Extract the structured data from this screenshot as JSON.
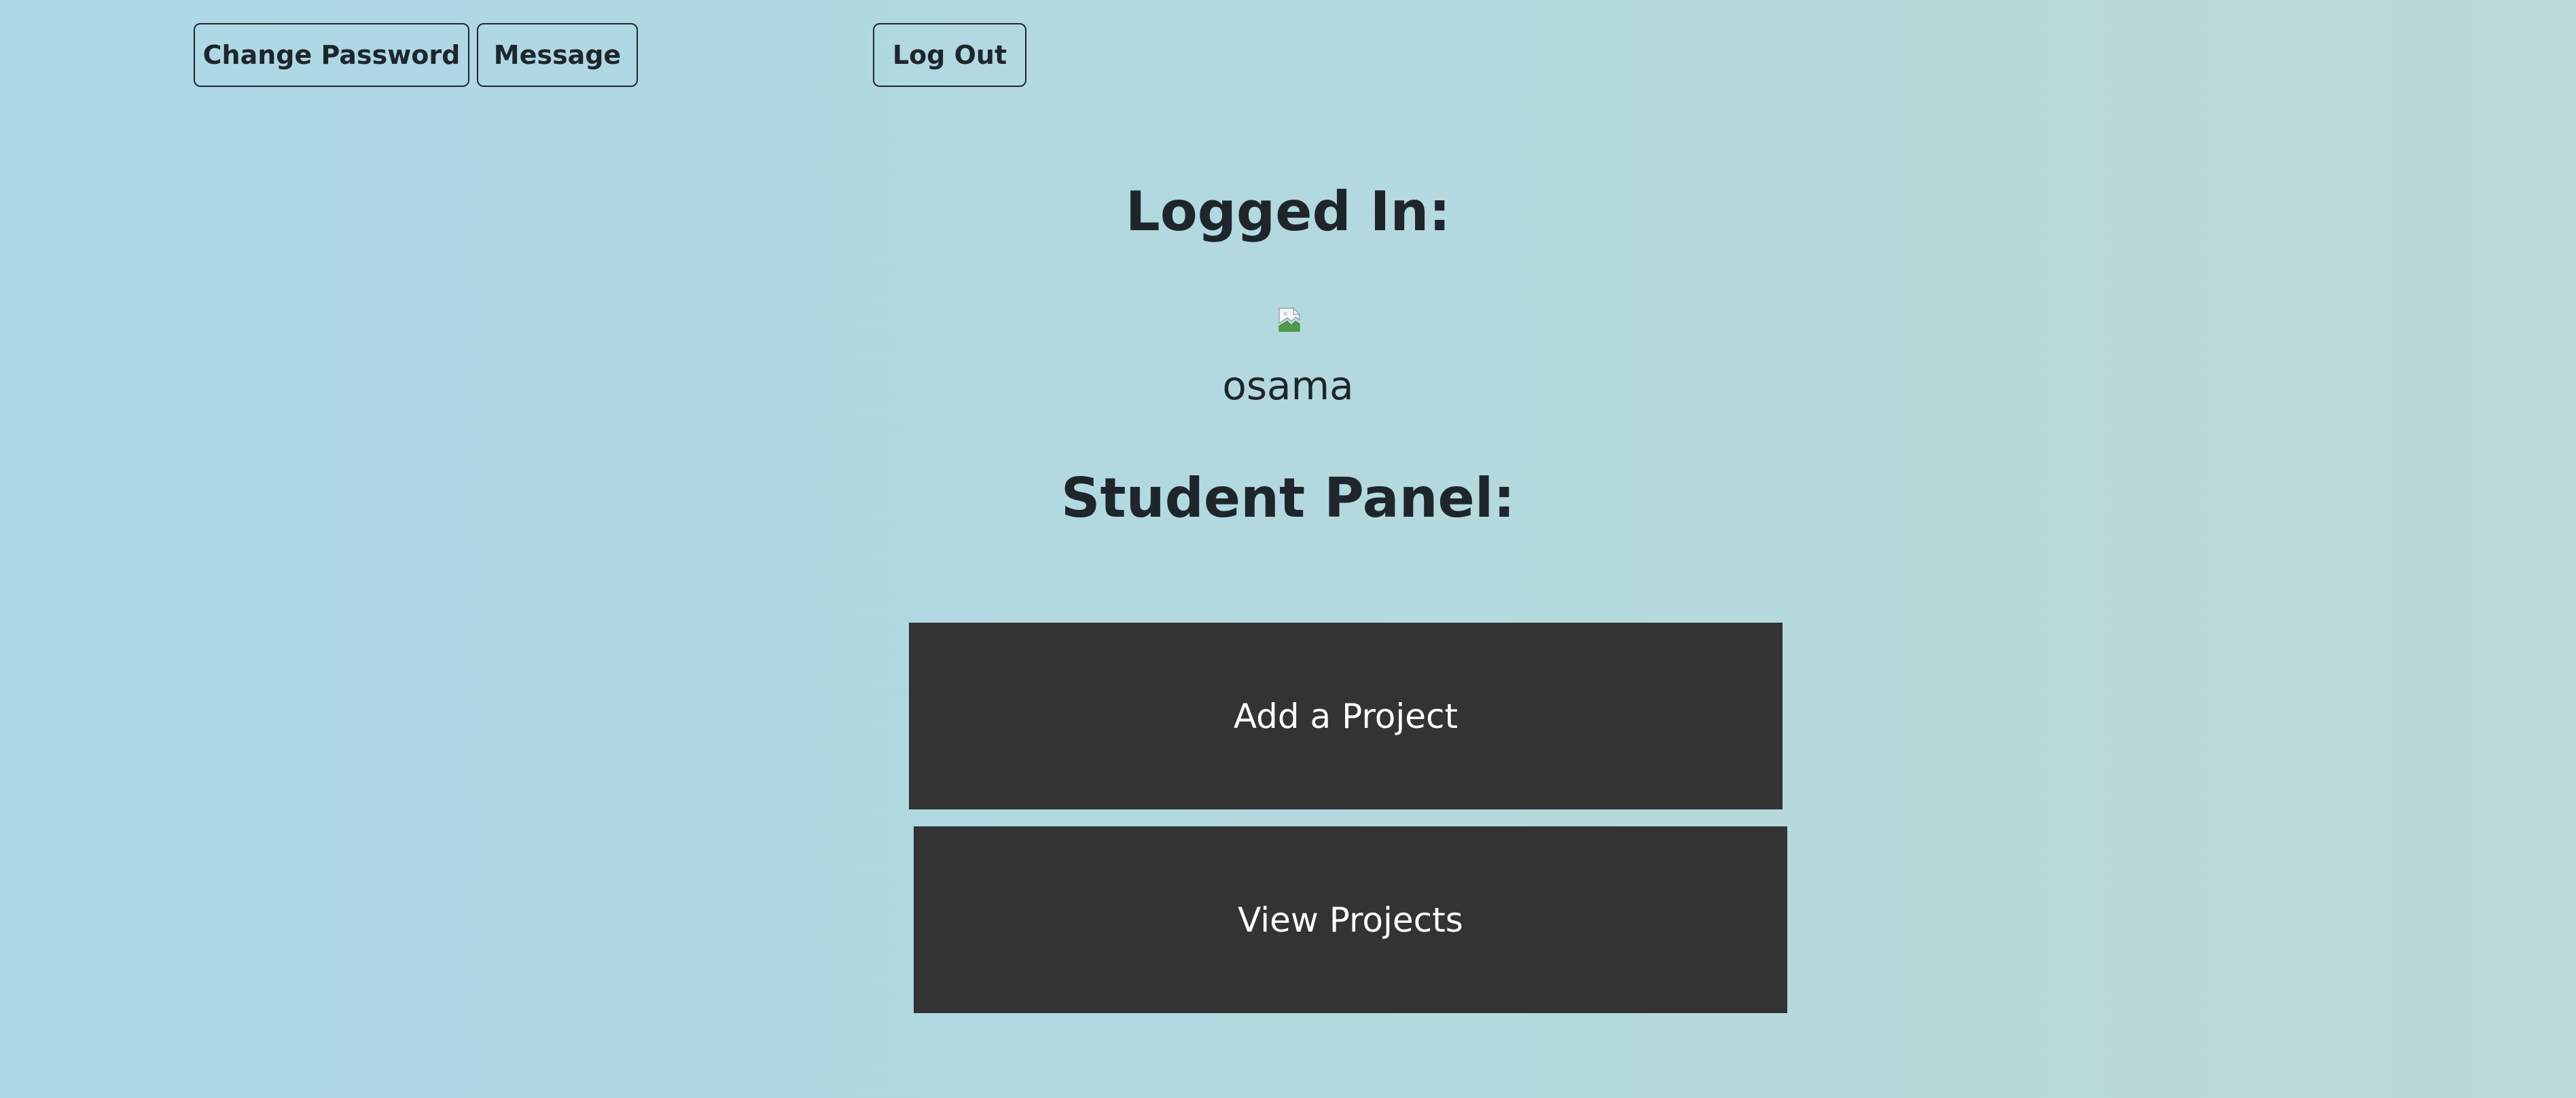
{
  "topbar": {
    "change_password_label": "Change Password",
    "message_label": "Message",
    "logout_label": "Log Out"
  },
  "main": {
    "logged_in_heading": "Logged In:",
    "avatar_icon": "broken-image-icon",
    "username": "osama",
    "panel_heading": "Student Panel:",
    "add_project_label": "Add a Project",
    "view_projects_label": "View Projects"
  },
  "colors": {
    "background_start": "#add8e6",
    "background_end": "#b9dad6",
    "text": "#1e262c",
    "panel_button_bg": "#333333",
    "panel_button_text": "#ffffff"
  }
}
